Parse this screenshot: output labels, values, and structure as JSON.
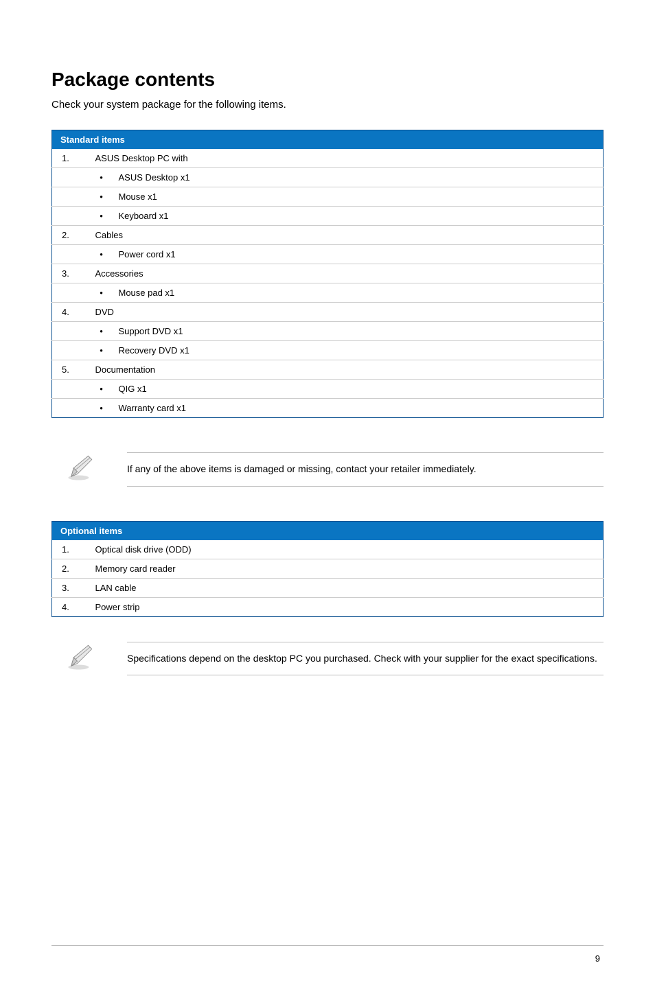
{
  "title": "Package contents",
  "intro": "Check your system package for the following items.",
  "standard_header": "Standard items",
  "standard_rows": [
    {
      "num": "1.",
      "text": "ASUS Desktop PC with",
      "bullet": false
    },
    {
      "num": "",
      "text": "ASUS Desktop x1",
      "bullet": true
    },
    {
      "num": "",
      "text": "Mouse x1",
      "bullet": true
    },
    {
      "num": "",
      "text": "Keyboard x1",
      "bullet": true
    },
    {
      "num": "2.",
      "text": "Cables",
      "bullet": false
    },
    {
      "num": "",
      "text": "Power cord x1",
      "bullet": true
    },
    {
      "num": "3.",
      "text": "Accessories",
      "bullet": false
    },
    {
      "num": "",
      "text": "Mouse pad x1",
      "bullet": true
    },
    {
      "num": "4.",
      "text": "DVD",
      "bullet": false
    },
    {
      "num": "",
      "text": "Support DVD x1",
      "bullet": true
    },
    {
      "num": "",
      "text": "Recovery DVD x1",
      "bullet": true
    },
    {
      "num": "5.",
      "text": "Documentation",
      "bullet": false
    },
    {
      "num": "",
      "text": "QIG x1",
      "bullet": true
    },
    {
      "num": "",
      "text": "Warranty card x1",
      "bullet": true
    }
  ],
  "note1": "If any of the above items is damaged or missing, contact your retailer immediately.",
  "optional_header": "Optional items",
  "optional_rows": [
    {
      "num": "1.",
      "text": "Optical disk drive (ODD)"
    },
    {
      "num": "2.",
      "text": "Memory card reader"
    },
    {
      "num": "3.",
      "text": "LAN cable"
    },
    {
      "num": "4.",
      "text": "Power strip"
    }
  ],
  "note2": "Specifications depend on the desktop PC you purchased. Check with your supplier for the exact specifications.",
  "page_number": "9"
}
